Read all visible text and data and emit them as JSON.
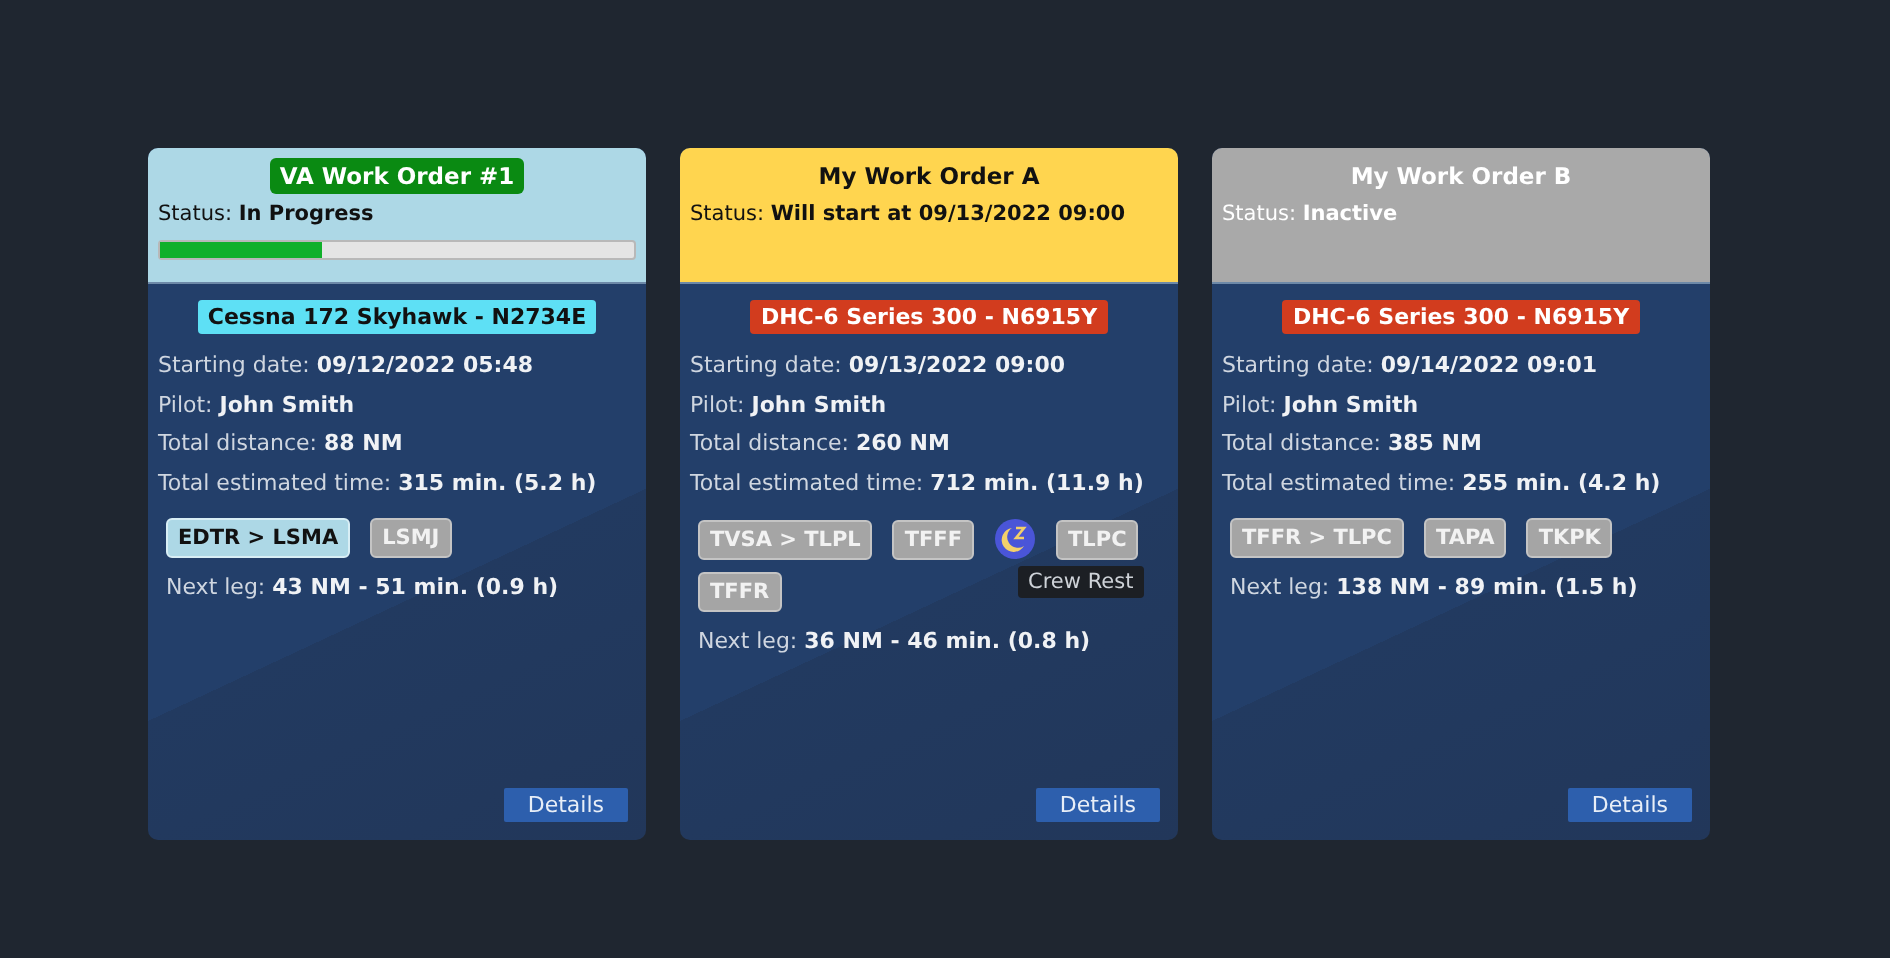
{
  "work_orders": [
    {
      "kind": "progress",
      "title": "VA Work Order #1",
      "status": "Status: **In Progress**",
      "level": 0.34,
      "aircraft": {
        "label": "Cessna 172 Skyhawk - N2734E",
        "color": "#5ee0f5"
      },
      "info": [
        "Starting date: **09/12/2022 05:48**",
        "Pilot: **John Smith**",
        "Total distance: **88 NM**",
        "Total estimated time: **315 min. (5.2 h)**"
      ],
      "legs": [
        {
          "kind": "current",
          "label": "EDTR > LSMA"
        },
        {
          "kind": "pending",
          "label": "LSMJ"
        }
      ],
      "next_leg": "Next leg: **43 NM - 51 min. (0.9 h)**",
      "button": "Details"
    },
    {
      "kind": "scheduled",
      "title": "My Work Order A",
      "status": "Status: **Will start at 09/13/2022 09:00**",
      "aircraft": {
        "label": "DHC-6 Series 300 - N6915Y",
        "color": "#d23c1e"
      },
      "info": [
        "Starting date: **09/13/2022 09:00**",
        "Pilot: **John Smith**",
        "Total distance: **260 NM**",
        "Total estimated time: **712 min. (11.9 h)**"
      ],
      "legs": [
        {
          "kind": "pending",
          "label": "TVSA > TLPL"
        },
        {
          "kind": "pending",
          "label": "TFFF"
        },
        {
          "kind": "rest"
        },
        {
          "kind": "pending",
          "label": "TLPC"
        },
        {
          "kind": "pending",
          "label": "TFFR"
        }
      ],
      "next_leg": "Next leg: **36 NM - 46 min. (0.8 h)**",
      "tooltip": "Crew Rest",
      "button": "Details"
    },
    {
      "kind": "inactive",
      "title": "My Work Order B",
      "status": "Status: **Inactive**",
      "aircraft": {
        "label": "DHC-6 Series 300 - N6915Y",
        "color": "#d23c1e"
      },
      "info": [
        "Starting date: **09/14/2022 09:01**",
        "Pilot: **John Smith**",
        "Total distance: **385 NM**",
        "Total estimated time: **255 min. (4.2 h)**"
      ],
      "legs": [
        {
          "kind": "pending",
          "label": "TFFR > TLPC"
        },
        {
          "kind": "pending",
          "label": "TAPA"
        },
        {
          "kind": "pending",
          "label": "TKPK"
        }
      ],
      "next_leg": "Next leg: **138 NM - 89 min. (1.5 h)**",
      "button": "Details"
    }
  ]
}
